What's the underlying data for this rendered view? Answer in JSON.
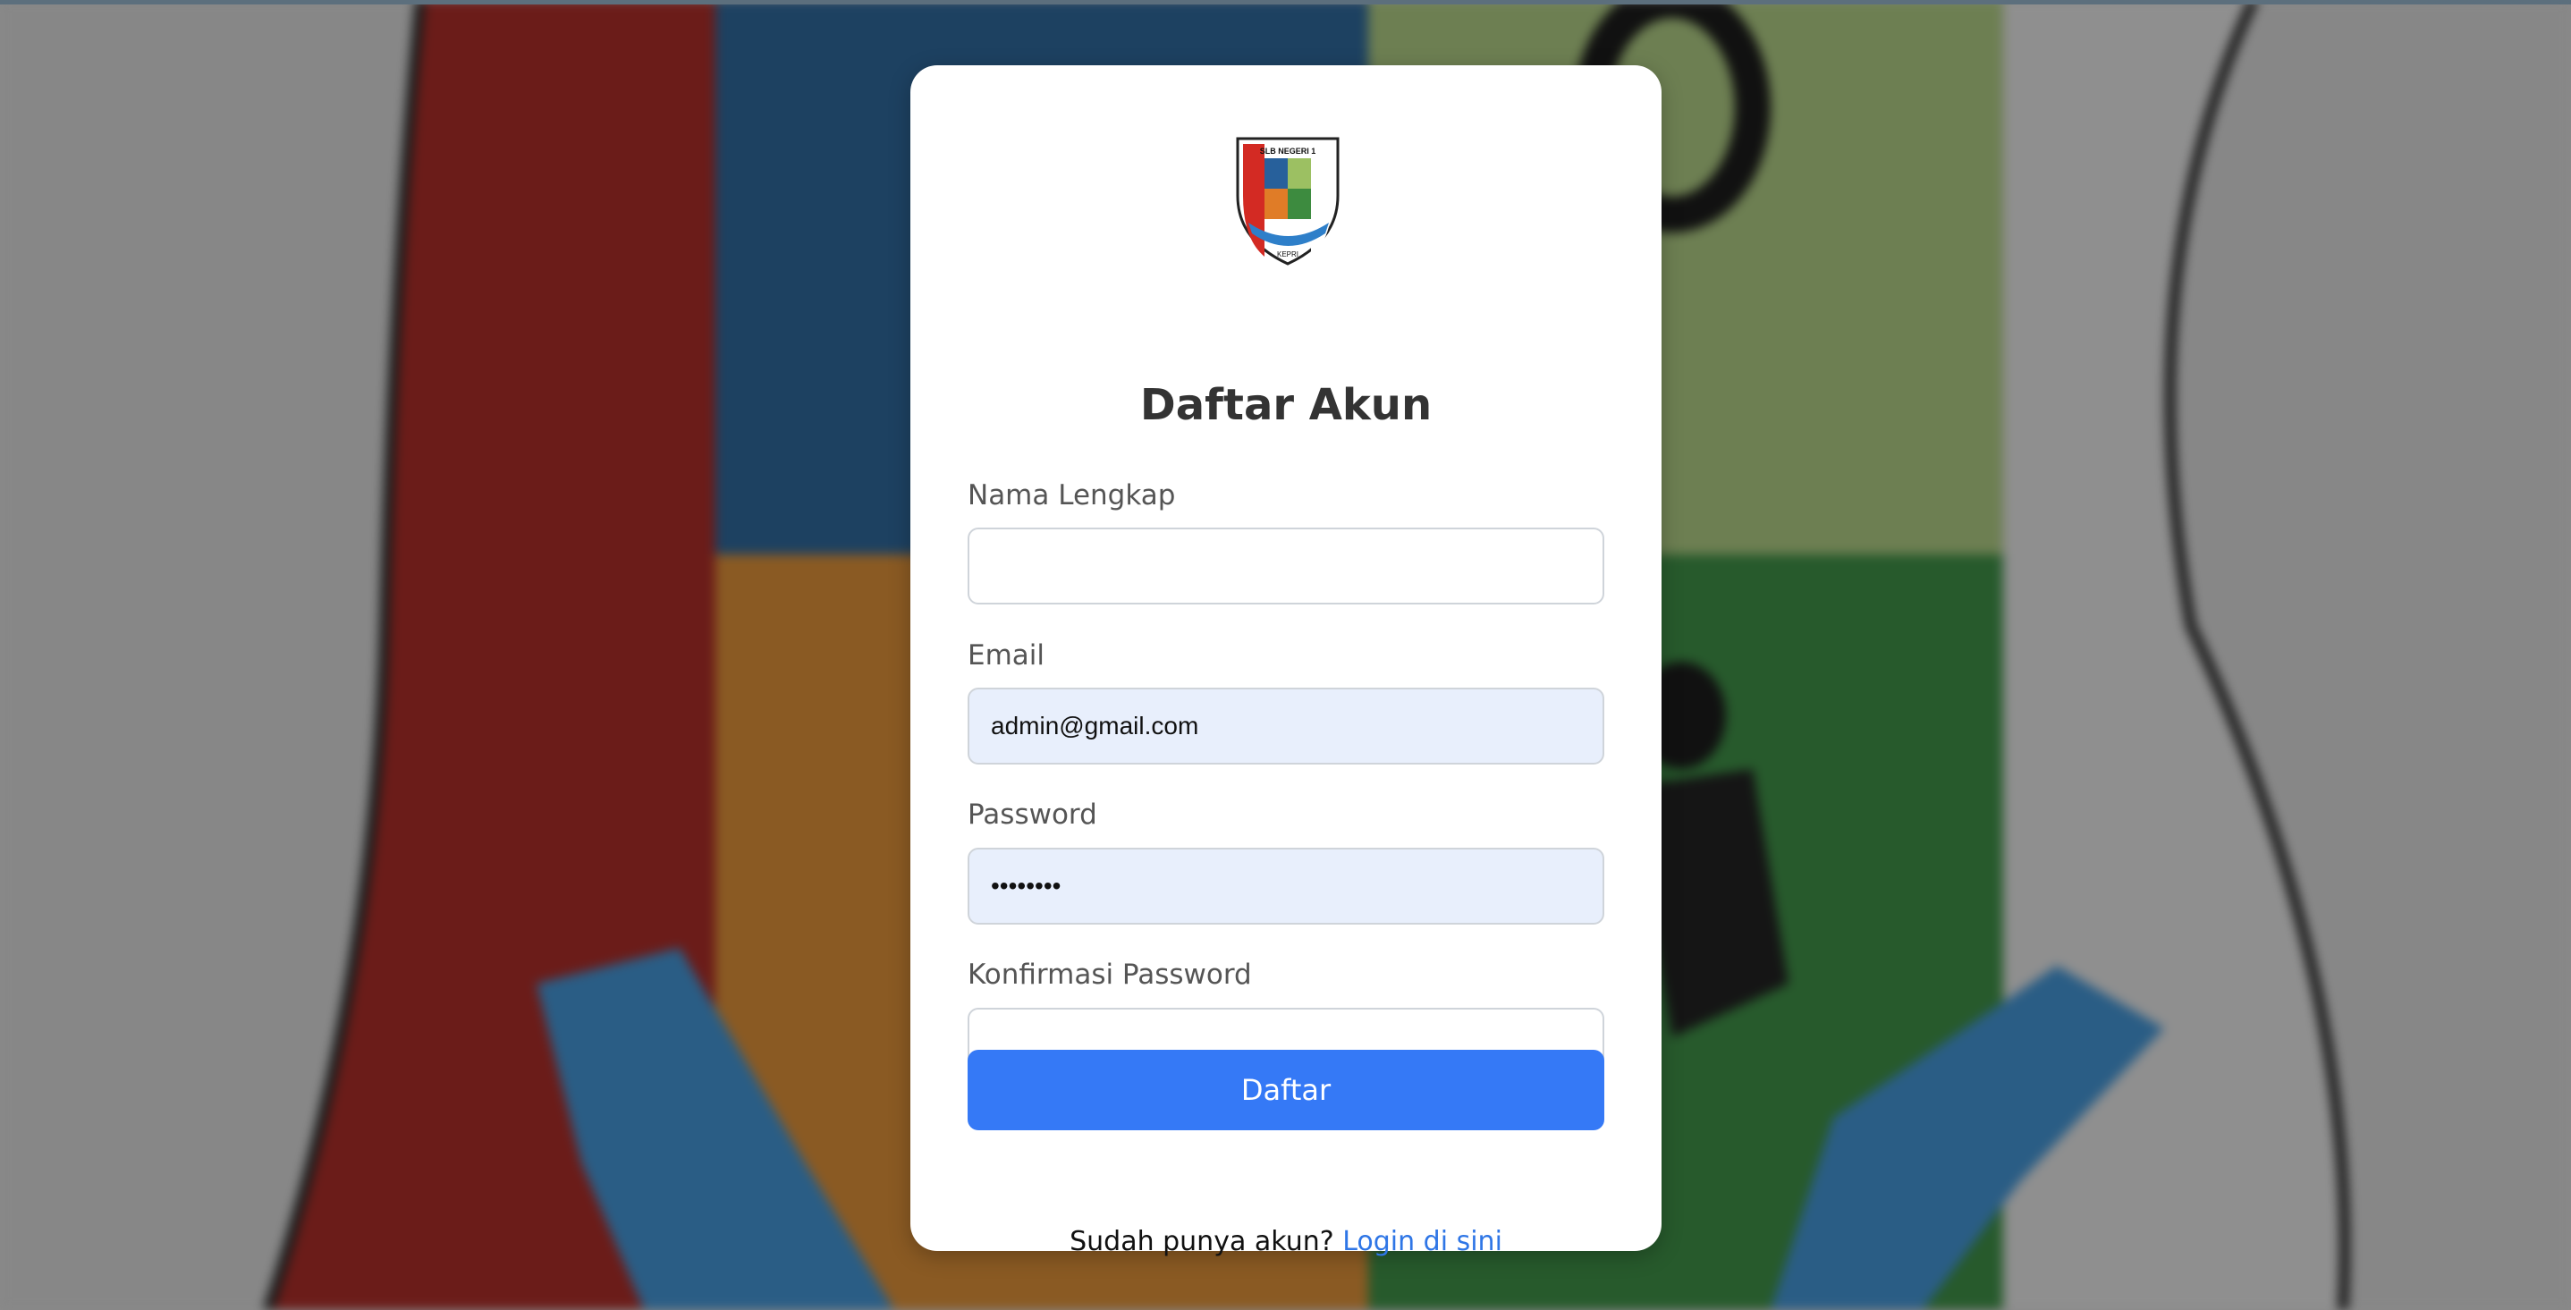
{
  "colors": {
    "accent": "#3579f6",
    "link": "#2f76e6",
    "filled_field_bg": "#e8effc"
  },
  "logo": {
    "icon": "school-crest-logo",
    "text_top": "SLB NEGERI 1",
    "text_bottom": "KEPRI"
  },
  "form": {
    "title": "Daftar Akun",
    "fields": [
      {
        "label": "Nama Lengkap",
        "value": ""
      },
      {
        "label": "Email",
        "value": "admin@gmail.com"
      },
      {
        "label": "Password",
        "value": "••••••••"
      },
      {
        "label": "Konfirmasi Password",
        "value": ""
      }
    ],
    "submit_label": "Daftar",
    "footer_text": "Sudah punya akun?",
    "footer_link": "Login di sini"
  }
}
